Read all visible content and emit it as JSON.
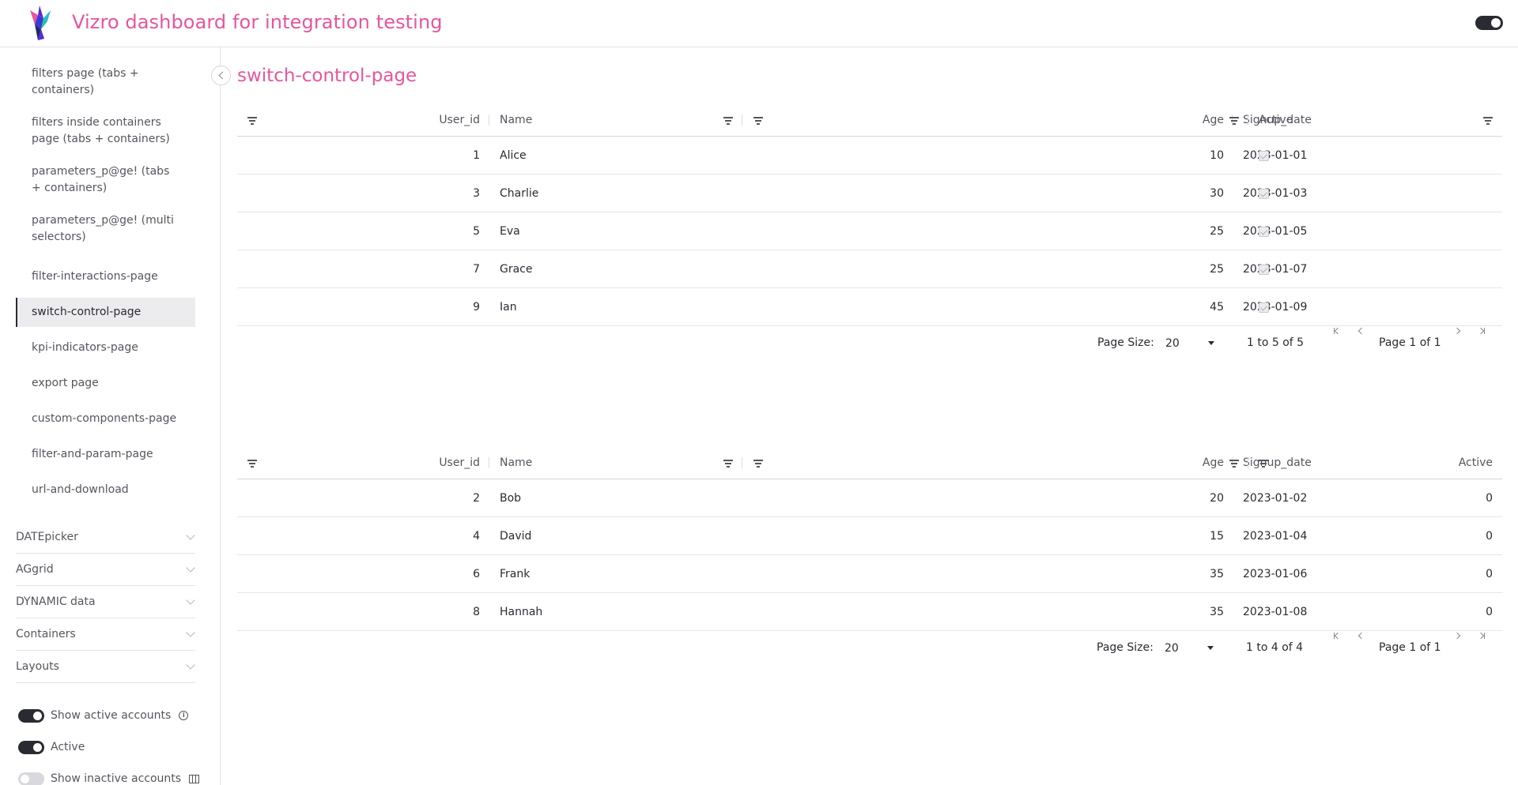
{
  "header": {
    "title": "Vizro dashboard for integration testing"
  },
  "sidebar": {
    "nav_items": [
      "filters page (tabs + containers)",
      "filters inside containers page (tabs + containers)",
      "parameters_p@ge! (tabs + containers)",
      "parameters_p@ge! (multi selectors)",
      "filter-interactions-page",
      "switch-control-page",
      "kpi-indicators-page",
      "export page",
      "custom-components-page",
      "filter-and-param-page",
      "url-and-download"
    ],
    "accordion": [
      "DATEpicker",
      "AGgrid",
      "DYNAMIC data",
      "Containers",
      "Layouts"
    ],
    "switches": {
      "show_active_label": "Show active accounts",
      "active_label": "Active",
      "show_inactive_label": "Show inactive accounts"
    }
  },
  "page": {
    "title": "switch-control-page"
  },
  "grid1": {
    "headers": {
      "user_id": "User_id",
      "name": "Name",
      "age": "Age",
      "signup": "Signup_date",
      "active": "Active"
    },
    "rows": [
      {
        "user_id": "1",
        "name": "Alice",
        "age": "10",
        "signup": "2023-01-01"
      },
      {
        "user_id": "3",
        "name": "Charlie",
        "age": "30",
        "signup": "2023-01-03"
      },
      {
        "user_id": "5",
        "name": "Eva",
        "age": "25",
        "signup": "2023-01-05"
      },
      {
        "user_id": "7",
        "name": "Grace",
        "age": "25",
        "signup": "2023-01-07"
      },
      {
        "user_id": "9",
        "name": "Ian",
        "age": "45",
        "signup": "2023-01-09"
      }
    ],
    "pager": {
      "page_size_label": "Page Size:",
      "page_size": "20",
      "range": "1 to 5 of 5",
      "page_text": "Page 1 of 1"
    }
  },
  "grid2": {
    "headers": {
      "user_id": "User_id",
      "name": "Name",
      "age": "Age",
      "signup": "Signup_date",
      "active": "Active"
    },
    "rows": [
      {
        "user_id": "2",
        "name": "Bob",
        "age": "20",
        "signup": "2023-01-02",
        "active": "0"
      },
      {
        "user_id": "4",
        "name": "David",
        "age": "15",
        "signup": "2023-01-04",
        "active": "0"
      },
      {
        "user_id": "6",
        "name": "Frank",
        "age": "35",
        "signup": "2023-01-06",
        "active": "0"
      },
      {
        "user_id": "8",
        "name": "Hannah",
        "age": "35",
        "signup": "2023-01-08",
        "active": "0"
      }
    ],
    "pager": {
      "page_size_label": "Page Size:",
      "page_size": "20",
      "range": "1 to 4 of 4",
      "page_text": "Page 1 of 1"
    }
  },
  "colors": {
    "accent": "#e8559b",
    "dark": "#2a2a33"
  }
}
